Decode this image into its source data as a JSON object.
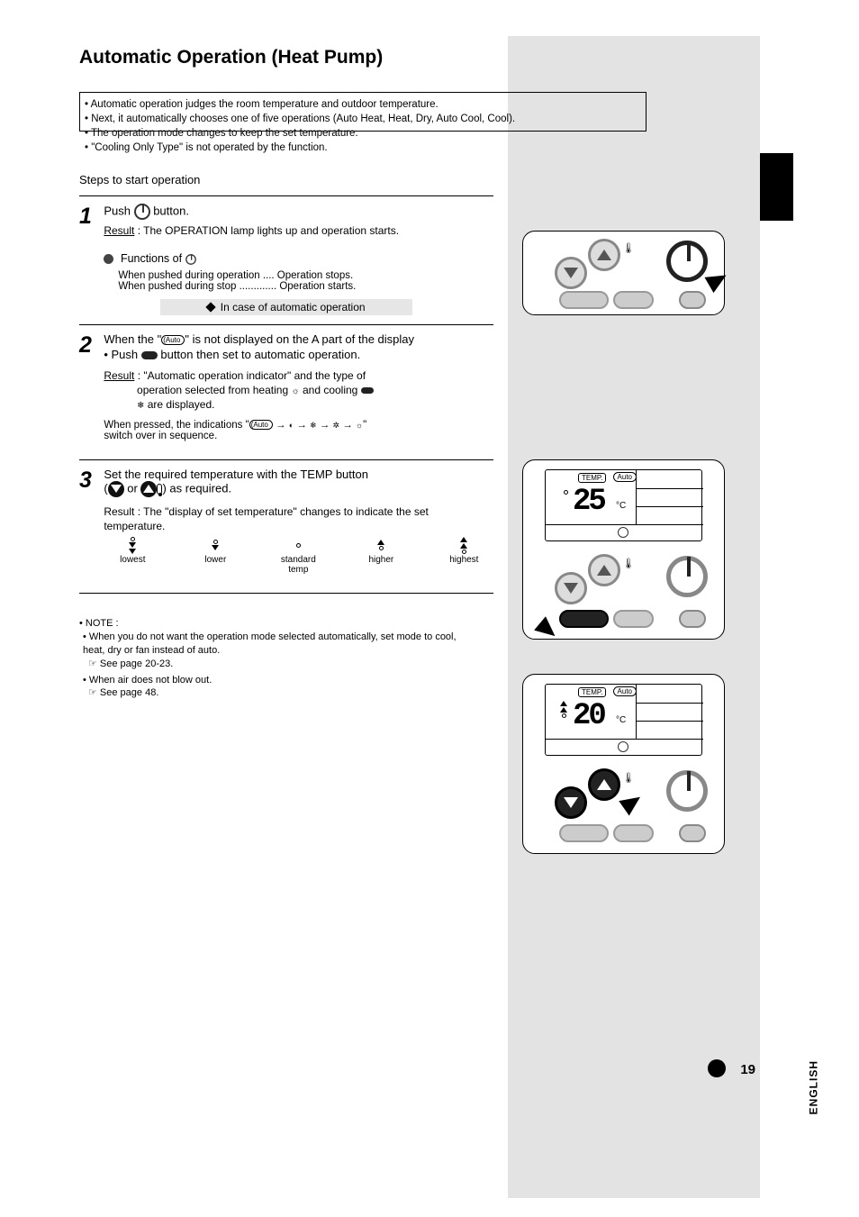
{
  "title": "Automatic Operation (Heat Pump)",
  "intro_lines": [
    "• Automatic operation judges the room temperature and outdoor temperature.",
    "• Next, it automatically chooses one of five operations (Auto Heat, Heat, Dry, Auto Cool, Cool).",
    "• The operation mode changes to keep the set temperature.",
    "• \"Cooling Only Type\" is not operated by the function."
  ],
  "steps_title": "Steps to start operation",
  "step1": {
    "num": "1",
    "line": "Push  button.",
    "sub1": "Result : The OPERATION lamp lights up and operation starts.",
    "heading": "Functions of ",
    "fn1": "When pushed during operation .... Operation stops.",
    "fn2": "When pushed during stop ............. Operation starts."
  },
  "section_label": "In case of automatic operation",
  "step2": {
    "num": "2",
    "line1a": "When the \"",
    "line1b": "Auto",
    "line1c": "\" is not displayed on the A part of the display",
    "line2": "• Push  button then set to automatic operation.",
    "sub": "Result : \"Automatic operation indicator\" and the type of",
    "sub2": "operation selected from heating  and cooling",
    "sub3": " are displayed.",
    "note": "When pressed, the indications \"",
    "seq": [
      "Auto",
      "→",
      "Dry",
      "→",
      "Cool",
      "→",
      "Fan",
      "→",
      "Heat"
    ],
    "note_end": "\"switch over in sequence."
  },
  "step3": {
    "num": "3",
    "line": "Set the required temperature with the TEMP button",
    "line2": "( or ) as required.",
    "sub": "Result : The \"display of set temperature\" changes to indicate the set temperature."
  },
  "indicators": {
    "lowest": "lowest",
    "lower": "lower",
    "std": "standard\ntemp",
    "higher": "higher",
    "highest": "highest"
  },
  "note_block": {
    "title": "• NOTE :",
    "line1": "• When you do not want the operation mode selected automatically, set mode to cool, heat, dry or fan instead of auto.",
    "see": "See page 20-23.",
    "line2": "• When air does not blow out.",
    "see2": "See page 48."
  },
  "remotes": {
    "r2_temp": "25",
    "r3_temp": "20",
    "temp_label": "TEMP.",
    "auto_label": "Auto"
  },
  "page_number": "19",
  "language": "ENGLISH"
}
